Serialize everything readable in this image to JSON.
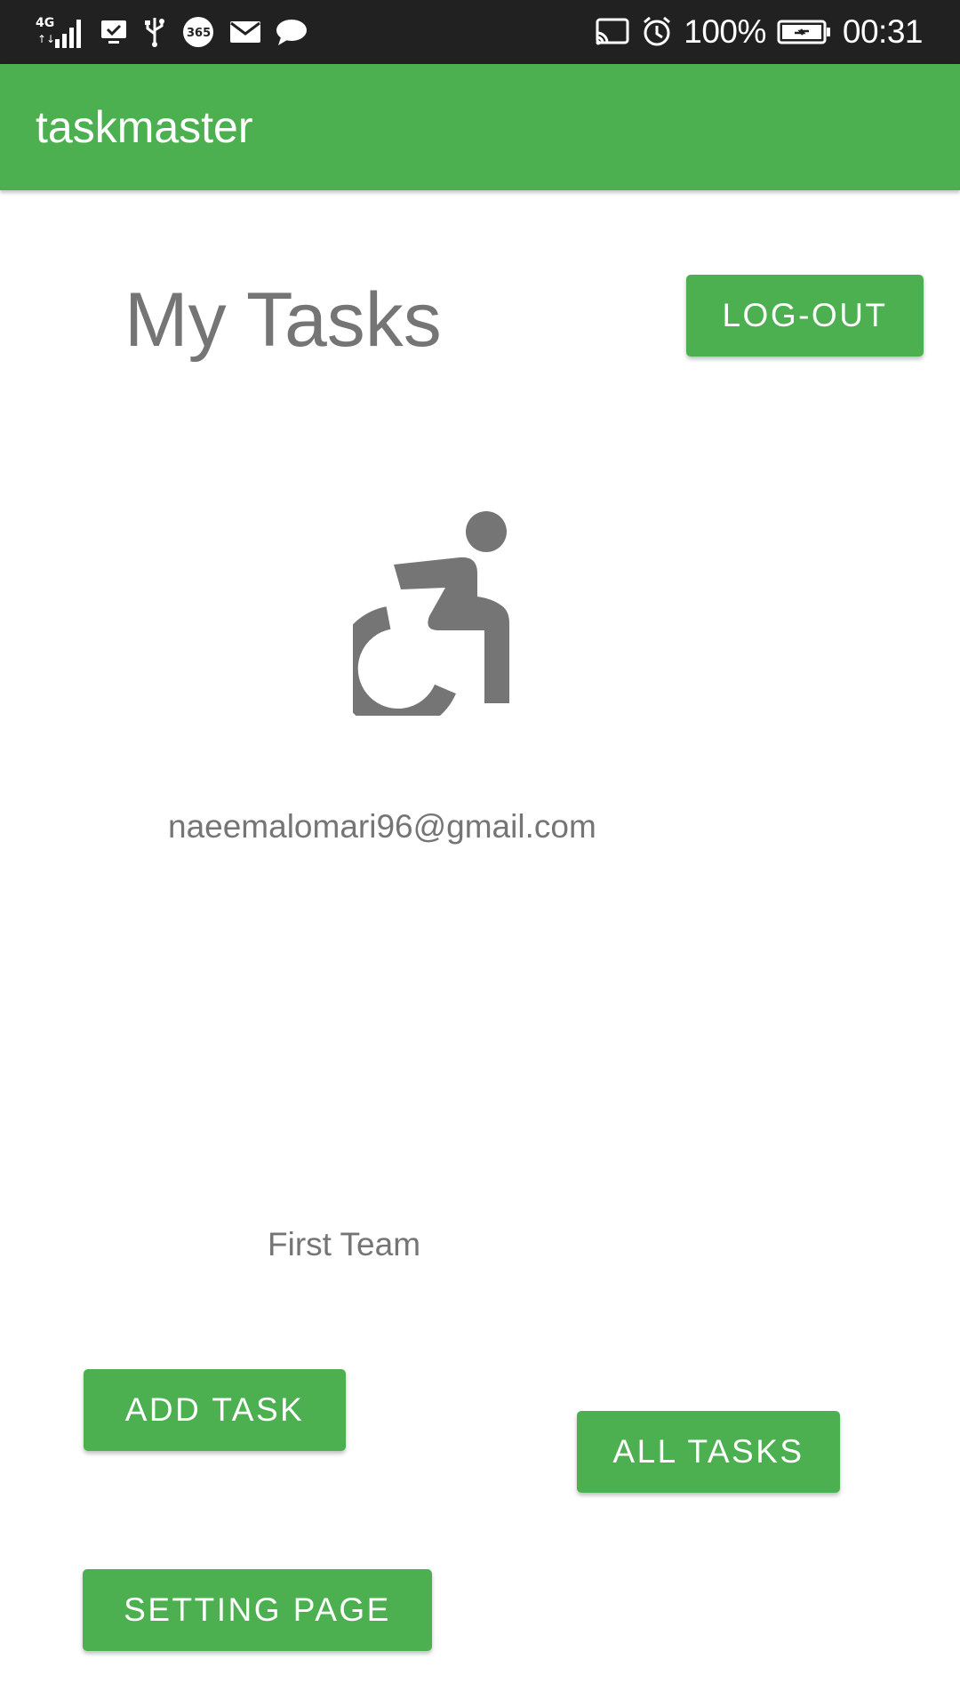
{
  "status_bar": {
    "network_label": "4G",
    "battery_percent": "100%",
    "time": "00:31",
    "left_icons": [
      "signal-icon",
      "screen-icon",
      "usb-icon",
      "office365-icon",
      "mail-icon",
      "chat-icon"
    ],
    "right_icons": [
      "cast-icon",
      "alarm-icon",
      "battery-charging-icon"
    ]
  },
  "app_bar": {
    "title": "taskmaster",
    "color": "#4caf50"
  },
  "main": {
    "page_title": "My Tasks",
    "logout_label": "LOG-OUT",
    "avatar_icon": "accessibility-wheelchair-icon",
    "email": "naeemalomari96@gmail.com",
    "team_name": "First Team",
    "add_task_label": "ADD TASK",
    "all_tasks_label": "ALL TASKS",
    "setting_page_label": "SETTING PAGE"
  }
}
